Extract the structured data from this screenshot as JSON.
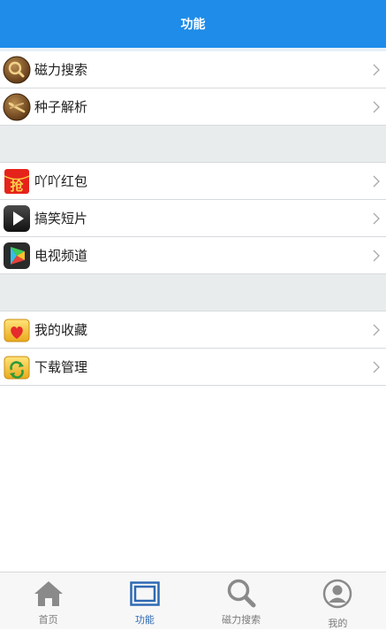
{
  "header": {
    "title": "功能"
  },
  "sections": [
    {
      "items": [
        {
          "label": "磁力搜索",
          "icon": "magnet-search-icon"
        },
        {
          "label": "种子解析",
          "icon": "torrent-parse-icon"
        }
      ]
    },
    {
      "items": [
        {
          "label": "吖吖红包",
          "icon": "red-packet-icon"
        },
        {
          "label": "搞笑短片",
          "icon": "play-video-icon"
        },
        {
          "label": "电视频道",
          "icon": "tv-channel-icon"
        }
      ]
    },
    {
      "items": [
        {
          "label": "我的收藏",
          "icon": "favorites-icon"
        },
        {
          "label": "下载管理",
          "icon": "download-manage-icon"
        }
      ]
    }
  ],
  "red_packet_glyph": "抢",
  "tabs": [
    {
      "label": "首页",
      "icon": "home-icon",
      "active": false
    },
    {
      "label": "功能",
      "icon": "function-icon",
      "active": true
    },
    {
      "label": "磁力搜索",
      "icon": "search-icon",
      "active": false
    },
    {
      "label": "我的",
      "icon": "profile-icon",
      "active": false
    }
  ],
  "colors": {
    "header": "#1e8ce8",
    "active_tab": "#2f6ab3",
    "section_gap": "#e9eced"
  }
}
